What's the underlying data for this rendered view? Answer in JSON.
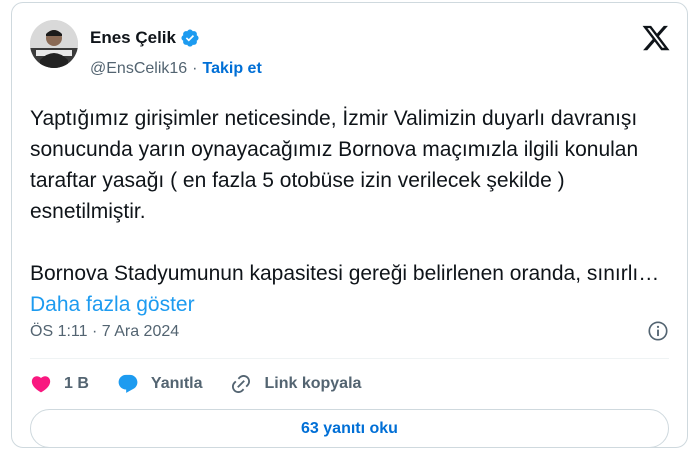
{
  "author": {
    "display_name": "Enes Çelik",
    "handle": "@EnsCelik16",
    "separator": "·",
    "follow_label": "Takip et"
  },
  "tweet": {
    "paragraph1": "Yaptığımız girişimler neticesinde, İzmir Valimizin duyarlı davranışı sonucunda yarın oynayacağımız Bornova maçımızla ilgili konulan taraftar yasağı ( en fazla 5 otobüse izin verilecek şekilde ) esnetilmiştir.",
    "paragraph2": "Bornova Stadyumunun kapasitesi gereği belirlenen oranda, sınırlı…",
    "show_more": "Daha fazla göster",
    "timestamp": "ÖS 1:11 · 7 Ara 2024"
  },
  "actions": {
    "likes": "1 B",
    "reply_label": "Yanıtla",
    "copy_link_label": "Link kopyala"
  },
  "read_replies_label": "63 yanıtı oku",
  "colors": {
    "link": "#1d9bf0",
    "follow": "#006fd6",
    "like": "#f91880",
    "reply": "#1d9bf0",
    "verified": "#1d9bf0",
    "muted": "#536471"
  },
  "icons": [
    "verified-badge-icon",
    "x-logo-icon",
    "info-icon",
    "heart-icon",
    "reply-bubble-icon",
    "link-icon"
  ]
}
